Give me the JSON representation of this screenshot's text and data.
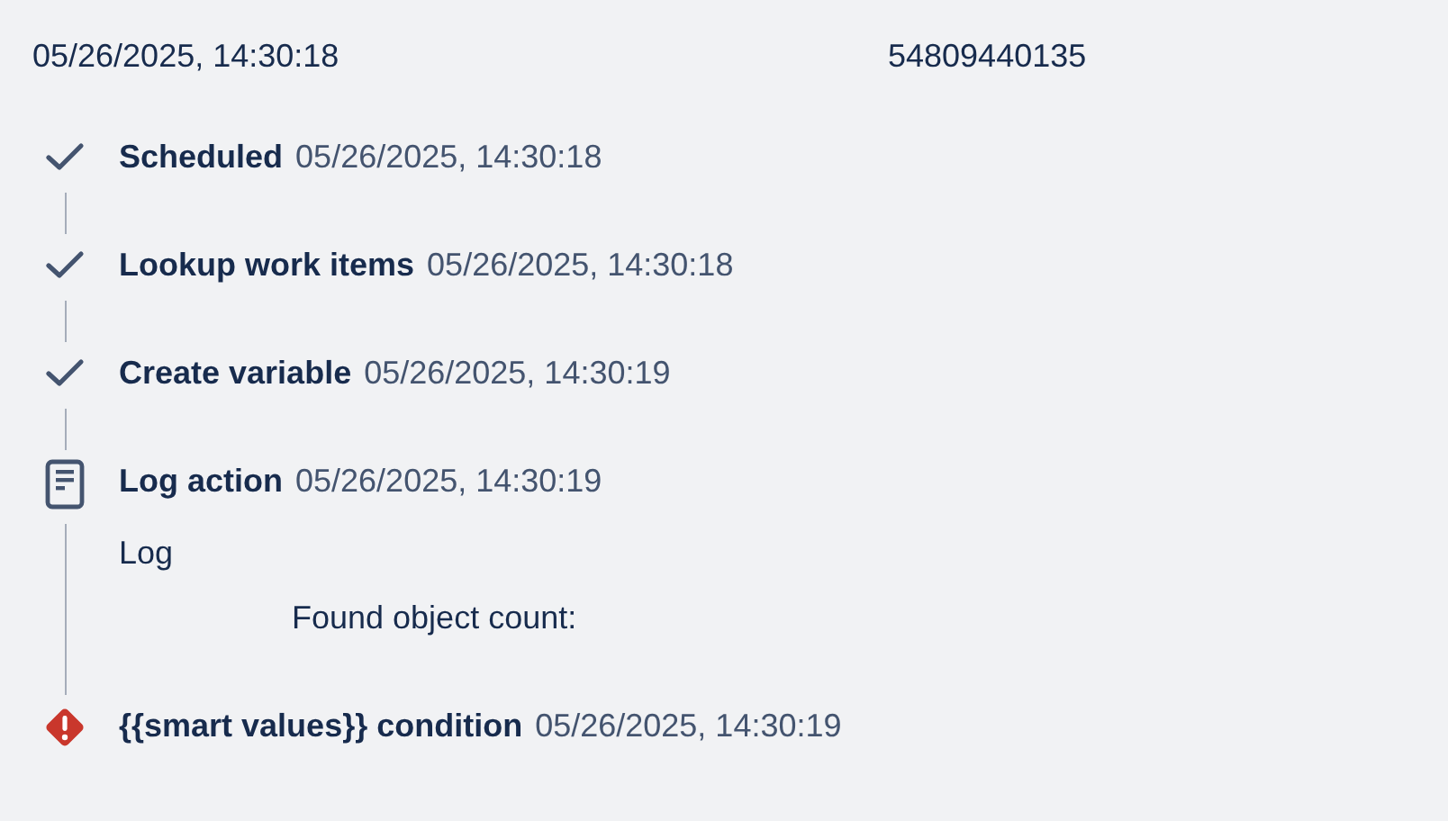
{
  "header": {
    "timestamp": "05/26/2025, 14:30:18",
    "id": "54809440135"
  },
  "steps": [
    {
      "kind": "success",
      "title": "Scheduled",
      "time": "05/26/2025, 14:30:18"
    },
    {
      "kind": "success",
      "title": "Lookup work items",
      "time": "05/26/2025, 14:30:18"
    },
    {
      "kind": "success",
      "title": "Create variable",
      "time": "05/26/2025, 14:30:19"
    },
    {
      "kind": "log",
      "title": "Log action",
      "time": "05/26/2025, 14:30:19",
      "details": [
        {
          "kind": "label",
          "text": "Log"
        },
        {
          "kind": "message",
          "text": "Found object count:"
        }
      ]
    },
    {
      "kind": "error",
      "title": "{{smart values}} condition",
      "time": "05/26/2025, 14:30:19"
    }
  ]
}
